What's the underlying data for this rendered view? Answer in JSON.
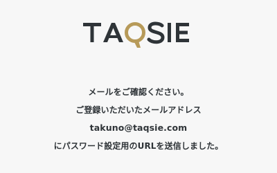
{
  "brand": {
    "logo_text": "TAQSIE",
    "text_color": "#2f3438",
    "accent_color": "#b79a59"
  },
  "message": {
    "line1": "メールをご確認ください。",
    "line2": "ご登録いただいたメールアドレス",
    "email": "takuno@taqsie.com",
    "line4": "にパスワード設定用のURLを送信しました。"
  },
  "colors": {
    "background": "#f7f7f7",
    "text": "#2f3438"
  }
}
